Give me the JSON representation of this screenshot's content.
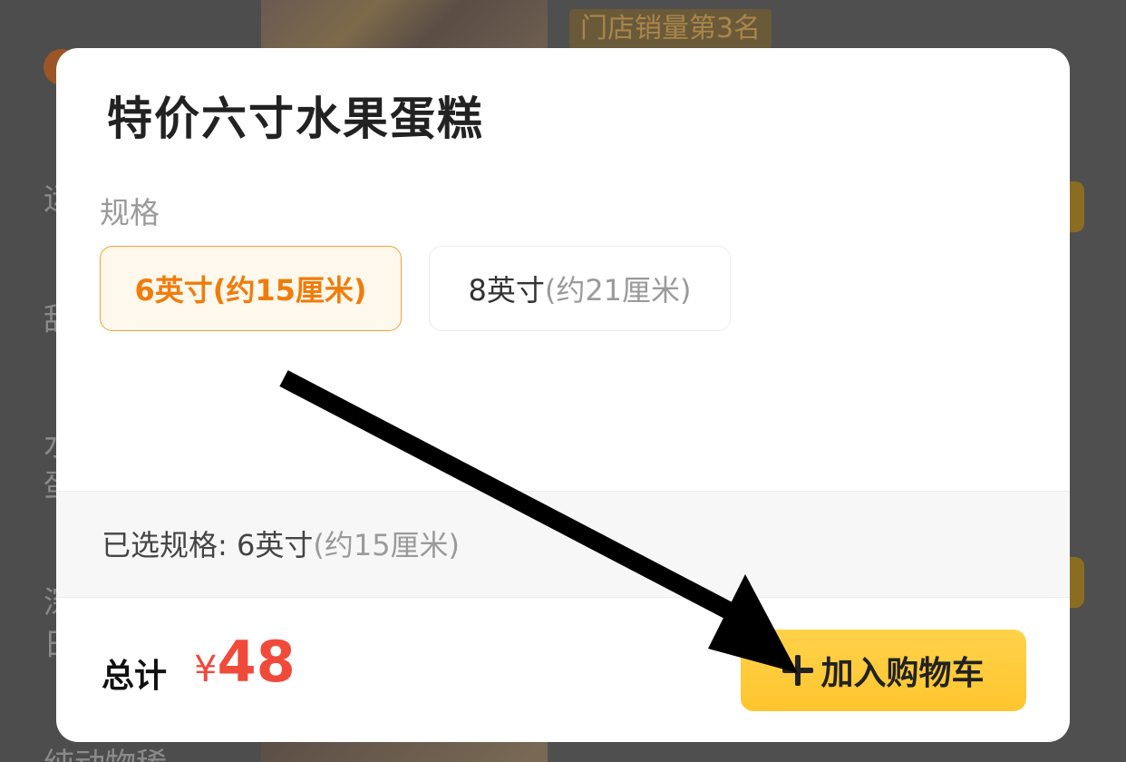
{
  "background": {
    "rank_tag": "门店销量第3名",
    "side_chars": [
      "运",
      "甜",
      "水",
      "蛋",
      "深",
      "日",
      "纯动物稀"
    ]
  },
  "modal": {
    "title": "特价六寸水果蛋糕",
    "spec_label": "规格",
    "options": [
      {
        "main": "6英寸",
        "sub": "(约15厘米)",
        "selected": true
      },
      {
        "main": "8英寸",
        "sub": "(约21厘米)",
        "selected": false
      }
    ],
    "selected_summary": {
      "prefix": "已选规格: ",
      "main": "6英寸",
      "sub": "(约15厘米)"
    },
    "total_label": "总计",
    "price": {
      "currency": "¥",
      "amount": "48"
    },
    "add_to_cart_label": "加入购物车"
  },
  "icons": {
    "add": "plus-icon",
    "annotation": "arrow-icon"
  },
  "colors": {
    "accent_orange": "#f07c0c",
    "price_red": "#f04a3a",
    "button_yellow": "#ffc52e"
  }
}
